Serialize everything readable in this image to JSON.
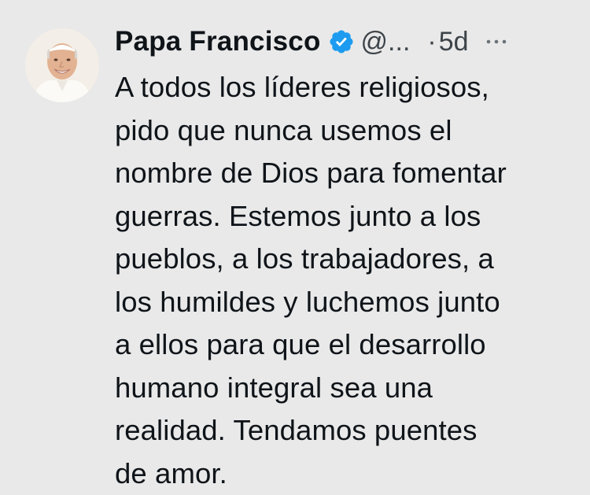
{
  "tweet": {
    "author": {
      "name": "Papa Francisco",
      "handle": "@...",
      "verified_icon": "verified-badge-icon",
      "avatar": "profile-photo"
    },
    "dot": "·",
    "time": "5d",
    "more_icon": "more-horizontal-icon",
    "text_lines": [
      "A todos los líderes religiosos,",
      "pido que nunca usemos el",
      "nombre de Dios para fomentar",
      "guerras. Estemos junto a los",
      "pueblos, a los trabajadores, a",
      "los humildes y luchemos junto",
      "a ellos para que el desarrollo",
      "humano integral sea una",
      "realidad. Tendamos puentes",
      "de amor."
    ]
  },
  "colors": {
    "background": "#e9e9e9",
    "text": "#0f1419",
    "secondary": "#3d4449",
    "verified": "#1d9bf0"
  }
}
